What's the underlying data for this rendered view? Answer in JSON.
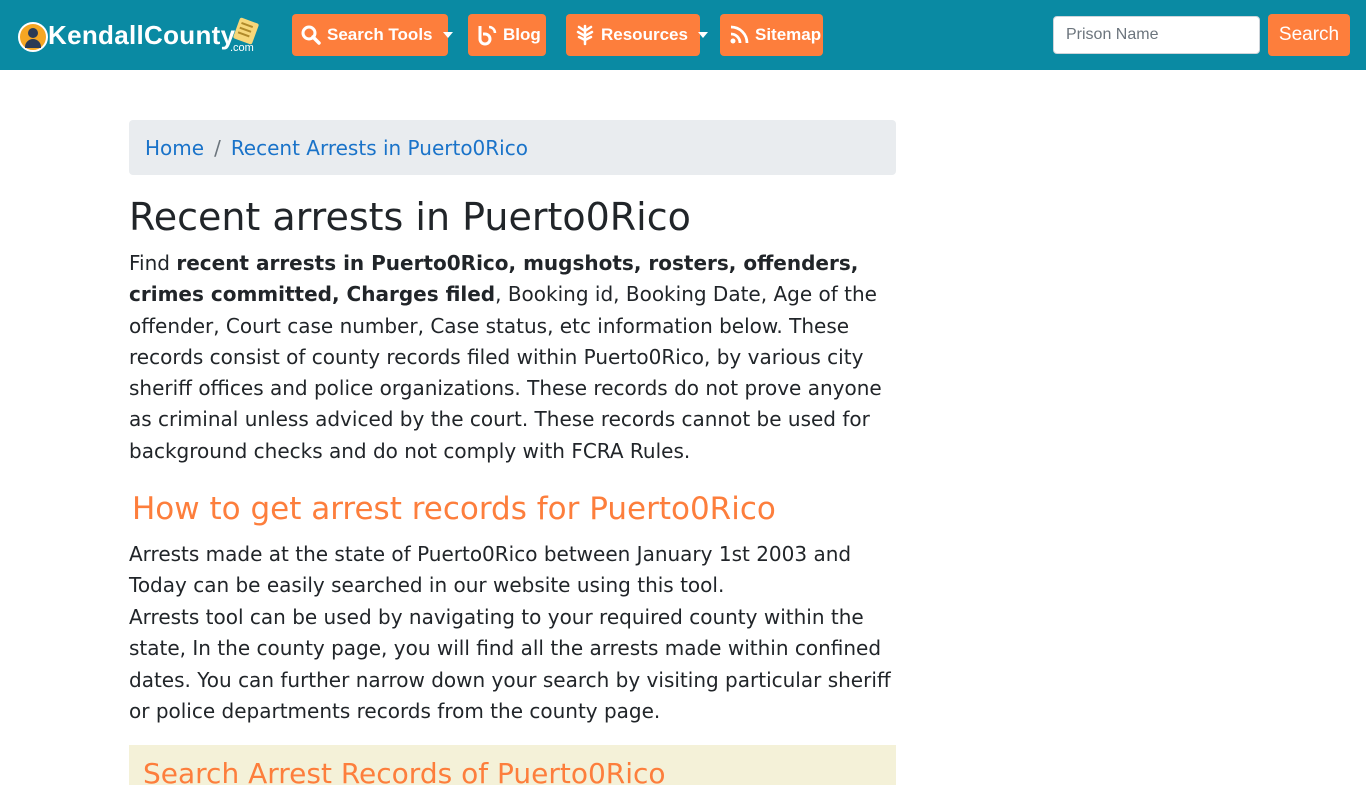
{
  "brand": {
    "name": "KendallCounty",
    "suffix": ".com"
  },
  "nav": {
    "search_tools": "Search Tools",
    "blog": "Blog",
    "resources": "Resources",
    "sitemap": "Sitemap"
  },
  "search": {
    "placeholder": "Prison Name",
    "button": "Search"
  },
  "breadcrumb": {
    "home": "Home",
    "current": "Recent Arrests in Puerto0Rico"
  },
  "title": "Recent arrests in Puerto0Rico",
  "intro": {
    "lead": "Find ",
    "bold": "recent arrests in Puerto0Rico, mugshots, rosters, offenders, crimes committed, Charges filed",
    "rest": ", Booking id, Booking Date, Age of the offender, Court case number, Case status, etc information below. These records consist of county records filed within Puerto0Rico, by various city sheriff offices and police organizations. These records do not prove anyone as criminal unless adviced by the court. These records cannot be used for background checks and do not comply with FCRA Rules."
  },
  "section_heading": "How to get arrest records for Puerto0Rico",
  "paragraphs": [
    "Arrests made at the state of Puerto0Rico between January 1st 2003 and Today can be easily searched in our website using this tool.",
    "Arrests tool can be used by navigating to your required county within the state, In the county page, you will find all the arrests made within confined dates. You can further narrow down your search by visiting particular sheriff or police departments records from the county page."
  ],
  "search_box_title": "Search Arrest Records of Puerto0Rico",
  "colors": {
    "navbar": "#0a8aa3",
    "accent": "#fd7e3c",
    "link": "#1a73c9"
  }
}
